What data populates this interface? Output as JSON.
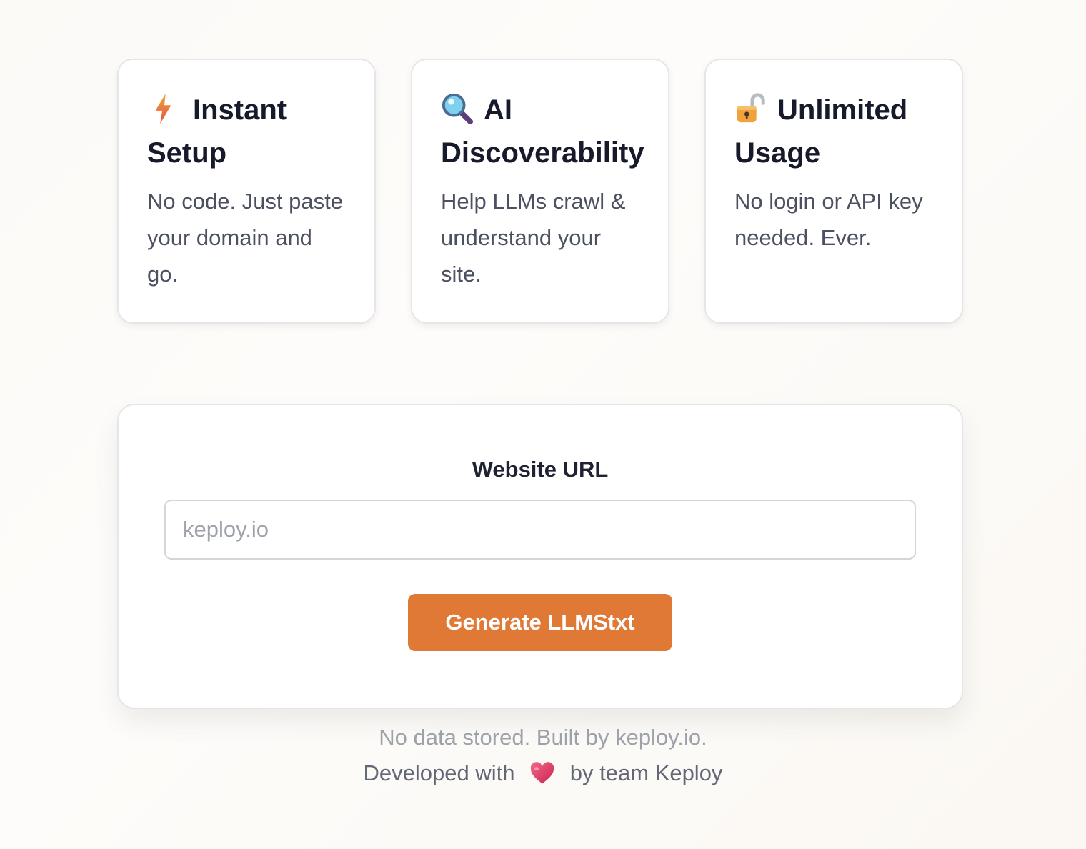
{
  "features": [
    {
      "icon": "lightning-icon",
      "title": "Instant Setup",
      "description": "No code. Just paste your domain and go."
    },
    {
      "icon": "magnifying-glass-icon",
      "title": "AI Discoverability",
      "description": "Help LLMs crawl & understand your site."
    },
    {
      "icon": "unlocked-padlock-icon",
      "title": "Unlimited Usage",
      "description": "No login or API key needed. Ever."
    }
  ],
  "form": {
    "label": "Website URL",
    "input_value": "",
    "input_placeholder": "keploy.io",
    "button_label": "Generate LLMStxt"
  },
  "footer": {
    "note": "No data stored. Built by keploy.io.",
    "developed_prefix": "Developed with",
    "heart_icon": "heart-icon",
    "developed_suffix": "by team Keploy"
  },
  "colors": {
    "accent": "#e07935",
    "heading": "#161a2b",
    "body_text": "#4b5161",
    "muted_text": "#9da1aa"
  }
}
